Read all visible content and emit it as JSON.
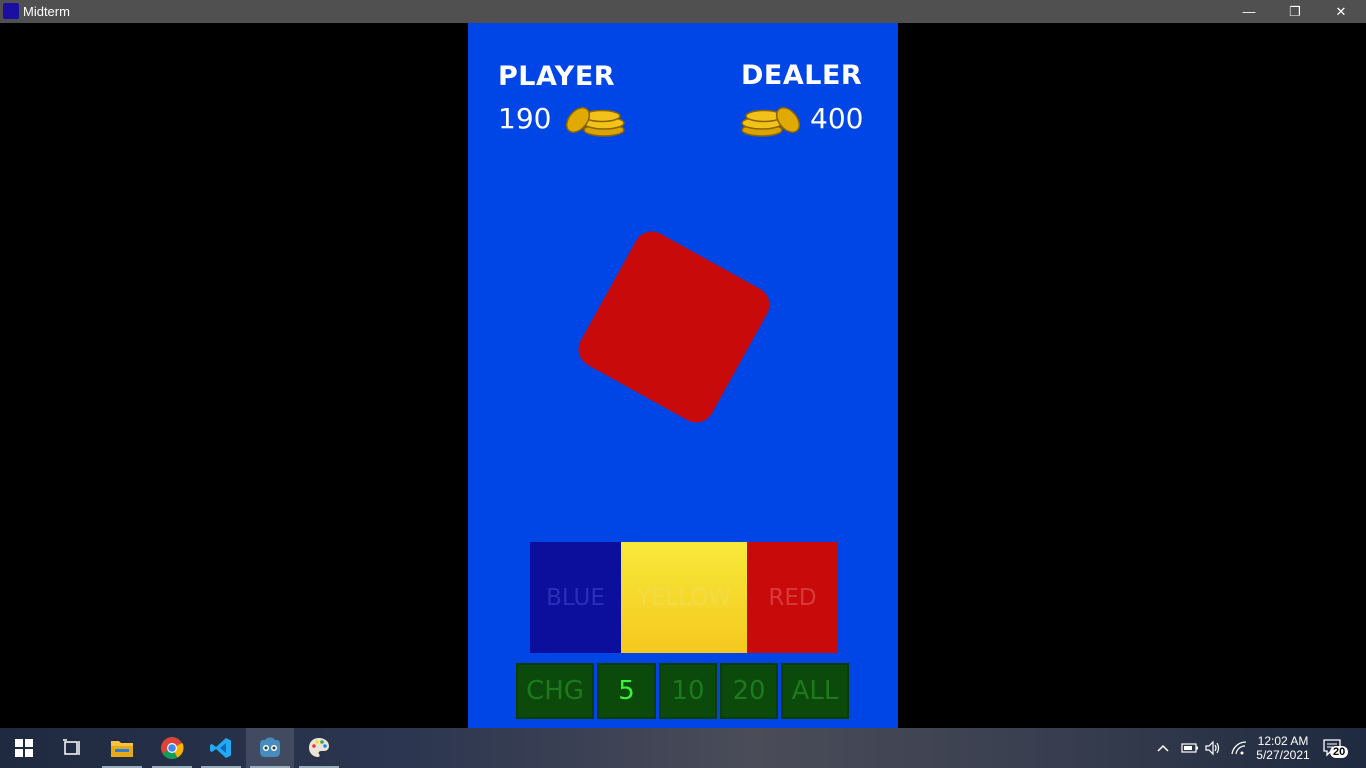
{
  "window": {
    "title": "Midterm",
    "minimize": "—",
    "restore": "❐",
    "close": "✕"
  },
  "player": {
    "label": "PLAYER",
    "coins": "190"
  },
  "dealer": {
    "label": "DEALER",
    "coins": "400"
  },
  "card": {
    "color": "#c80a0a"
  },
  "color_buttons": [
    {
      "label": "BLUE",
      "bg": "#0b0f9c",
      "text_color": "#2a2fb8"
    },
    {
      "label": "YELLOW",
      "bg": "#f5d62a",
      "text_color": "#f2dc47"
    },
    {
      "label": "RED",
      "bg": "#c80a0a",
      "text_color": "#d83a3a"
    }
  ],
  "bet_buttons": [
    {
      "label": "CHG",
      "selected": false
    },
    {
      "label": "5",
      "selected": true
    },
    {
      "label": "10",
      "selected": false
    },
    {
      "label": "20",
      "selected": false
    },
    {
      "label": "ALL",
      "selected": false
    }
  ],
  "taskbar": {
    "apps": [
      "windows-start",
      "task-view",
      "file-explorer",
      "chrome",
      "vscode",
      "godot",
      "paint"
    ],
    "time": "12:02 AM",
    "date": "5/27/2021",
    "notifications": "20"
  }
}
